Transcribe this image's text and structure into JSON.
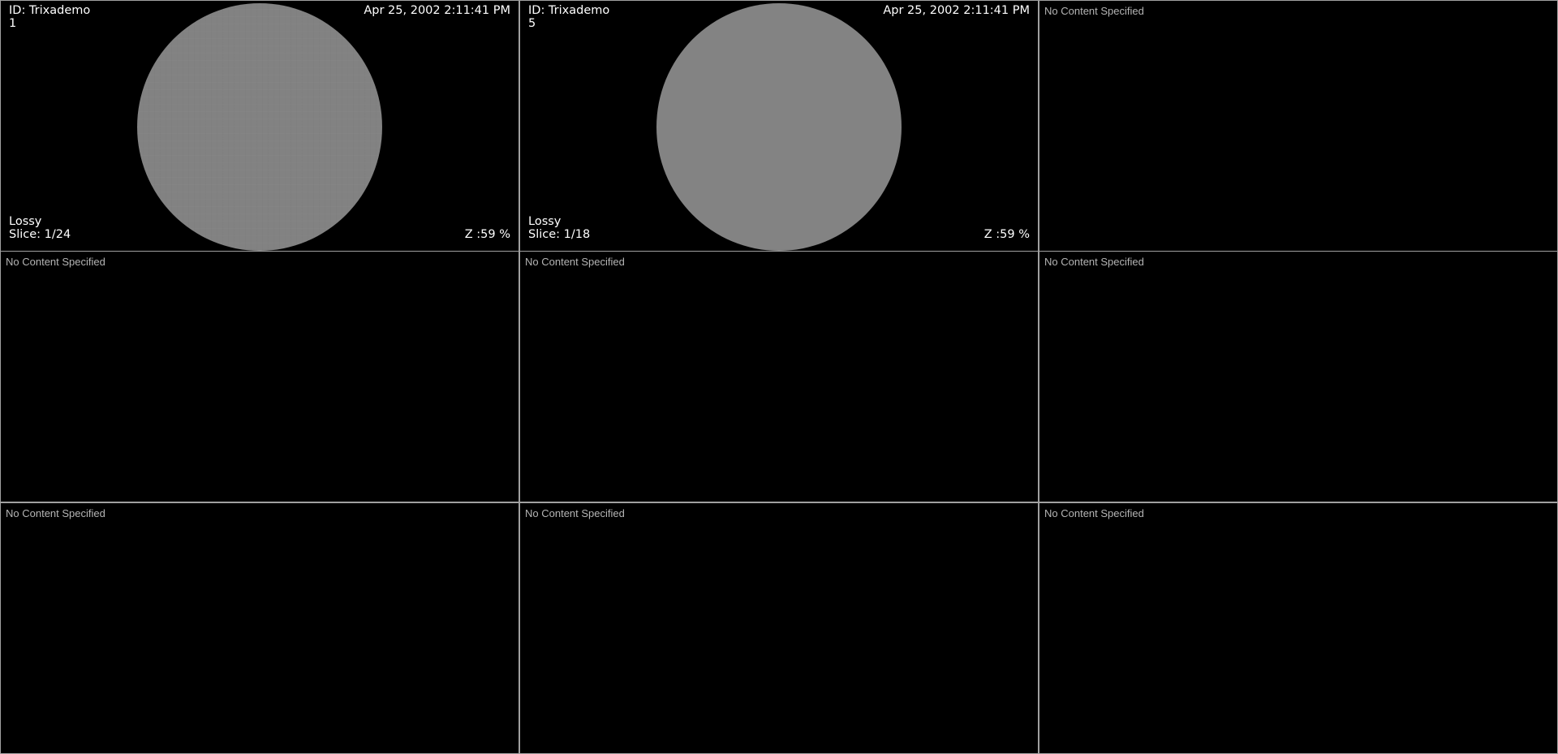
{
  "viewports": [
    {
      "id_label": "ID: Trixademo",
      "series": "1",
      "datetime": "Apr 25, 2002 2:11:41 PM",
      "compression": "Lossy",
      "slice": "Slice: 1/24",
      "zoom": "Z :59 %"
    },
    {
      "id_label": "ID: Trixademo",
      "series": "5",
      "datetime": "Apr 25, 2002 2:11:41 PM",
      "compression": "Lossy",
      "slice": "Slice: 1/18",
      "zoom": "Z :59 %"
    },
    {
      "empty_text": "No Content Specified"
    },
    {
      "empty_text": "No Content Specified"
    },
    {
      "empty_text": "No Content Specified"
    },
    {
      "empty_text": "No Content Specified"
    },
    {
      "empty_text": "No Content Specified"
    },
    {
      "empty_text": "No Content Specified"
    },
    {
      "empty_text": "No Content Specified"
    }
  ],
  "colors": {
    "background": "#000000",
    "border": "#a0a0a0",
    "phantom": "#838383",
    "overlay_text": "#ffffff",
    "empty_text": "#b4b4b4"
  }
}
